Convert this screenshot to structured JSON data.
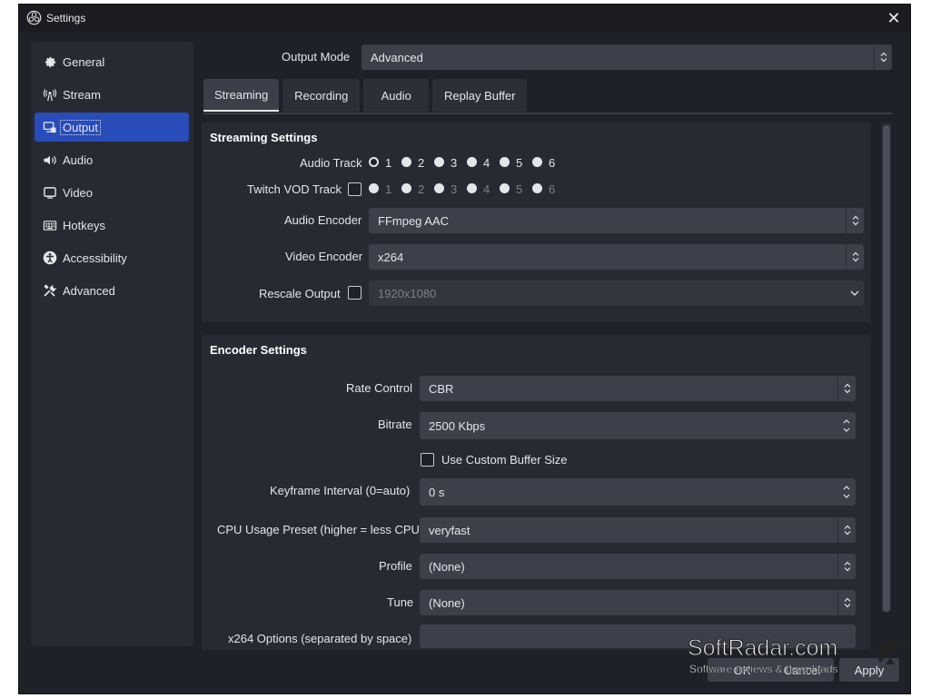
{
  "window": {
    "title": "Settings",
    "close_label": "✕"
  },
  "sidebar": {
    "items": [
      {
        "label": "General",
        "icon": "gear-icon"
      },
      {
        "label": "Stream",
        "icon": "antenna-icon"
      },
      {
        "label": "Output",
        "icon": "output-icon",
        "active": true
      },
      {
        "label": "Audio",
        "icon": "speaker-icon"
      },
      {
        "label": "Video",
        "icon": "monitor-icon"
      },
      {
        "label": "Hotkeys",
        "icon": "keyboard-icon"
      },
      {
        "label": "Accessibility",
        "icon": "accessibility-icon"
      },
      {
        "label": "Advanced",
        "icon": "tools-icon"
      }
    ]
  },
  "output_mode": {
    "label": "Output Mode",
    "value": "Advanced"
  },
  "tabs": [
    {
      "label": "Streaming",
      "active": true
    },
    {
      "label": "Recording"
    },
    {
      "label": "Audio"
    },
    {
      "label": "Replay Buffer"
    }
  ],
  "streaming_settings": {
    "title": "Streaming Settings",
    "audio_track_label": "Audio Track",
    "twitch_vod_label": "Twitch VOD Track",
    "tracks": [
      "1",
      "2",
      "3",
      "4",
      "5",
      "6"
    ],
    "audio_encoder_label": "Audio Encoder",
    "audio_encoder_value": "FFmpeg AAC",
    "video_encoder_label": "Video Encoder",
    "video_encoder_value": "x264",
    "rescale_label": "Rescale Output",
    "rescale_value": "1920x1080"
  },
  "encoder_settings": {
    "title": "Encoder Settings",
    "rate_control_label": "Rate Control",
    "rate_control_value": "CBR",
    "bitrate_label": "Bitrate",
    "bitrate_value": "2500 Kbps",
    "custom_buffer_label": "Use Custom Buffer Size",
    "keyframe_label": "Keyframe Interval (0=auto)",
    "keyframe_value": "0 s",
    "cpu_preset_label": "CPU Usage Preset (higher = less CPU)",
    "cpu_preset_value": "veryfast",
    "profile_label": "Profile",
    "profile_value": "(None)",
    "tune_label": "Tune",
    "tune_value": "(None)",
    "x264_options_label": "x264 Options (separated by space)",
    "x264_options_value": ""
  },
  "buttons": {
    "ok": "OK",
    "cancel": "Cancel",
    "apply": "Apply"
  },
  "watermark": {
    "brand": "SoftRadar.com",
    "tagline": "Software reviews & downloads"
  },
  "colors": {
    "window_bg": "#1f2129",
    "panel_bg": "#272a33",
    "accent": "#284cb8",
    "field_bg": "#3c404b"
  }
}
